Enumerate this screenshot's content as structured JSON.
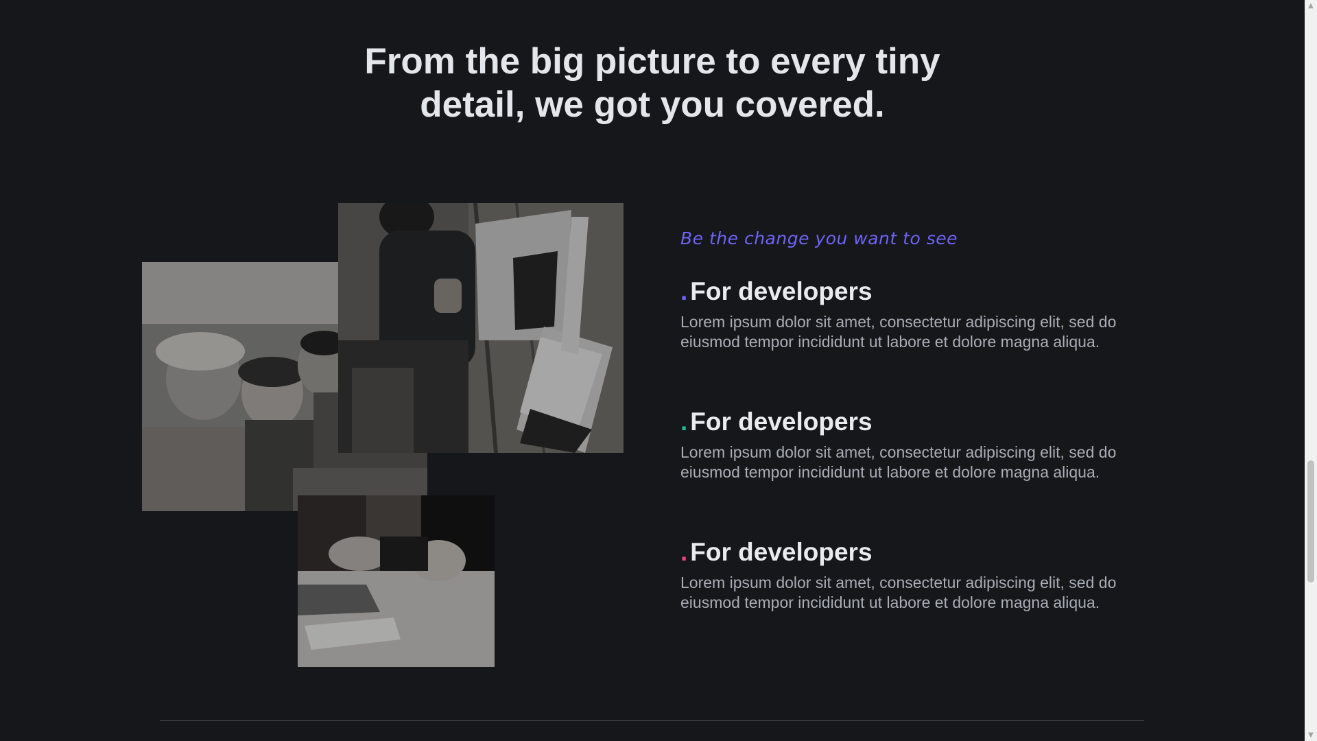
{
  "headline": {
    "line1": "From the big picture to every tiny",
    "line2": "detail, we got you covered."
  },
  "tagline": "Be the change you want to see",
  "features": [
    {
      "title": "For developers",
      "dot_color": "#6f63f6",
      "body": "Lorem ipsum dolor sit amet, consectetur adipiscing elit, sed do eiusmod tempor incididunt ut labore et dolore magna aliqua."
    },
    {
      "title": "For developers",
      "dot_color": "#21b89a",
      "body": "Lorem ipsum dolor sit amet, consectetur adipiscing elit, sed do eiusmod tempor incididunt ut labore et dolore magna aliqua."
    },
    {
      "title": "For developers",
      "dot_color": "#e8457c",
      "body": "Lorem ipsum dolor sit amet, consectetur adipiscing elit, sed do eiusmod tempor incididunt ut labore et dolore magna aliqua."
    }
  ],
  "dot_glyph": ".",
  "colors": {
    "background": "#15171a",
    "heading": "#e3e7ec",
    "body_text": "#a9adb6",
    "accent": "#6f63f6"
  },
  "scrollbar": {
    "up_icon": "caret-up-icon",
    "down_icon": "caret-down-icon",
    "scroll_position": 0.72
  }
}
